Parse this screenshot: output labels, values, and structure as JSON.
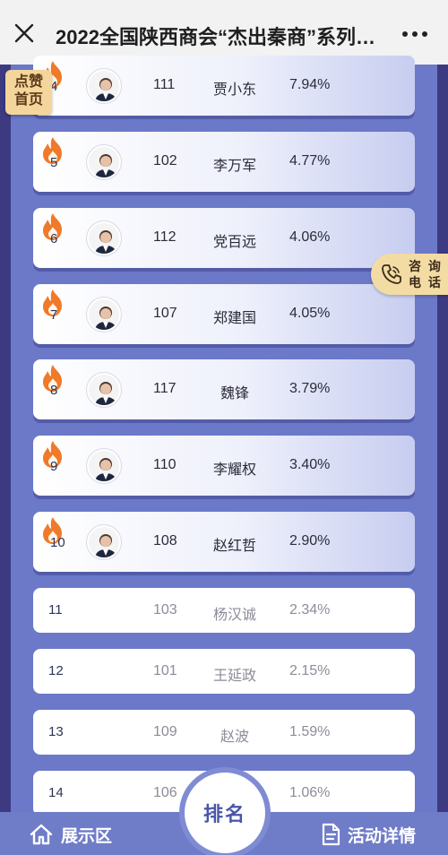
{
  "header": {
    "title": "2022全国陕西商会“杰出秦商”系列…",
    "close_icon": "close-icon",
    "more_icon": "more-icon"
  },
  "side_badges": {
    "like_line1": "点赞",
    "like_line2": "首页",
    "consult_line1": "咨 询",
    "consult_line2": "电 话"
  },
  "ranking": [
    {
      "rank": "4",
      "number": "111",
      "name": "贾小东",
      "percent": "7.94%"
    },
    {
      "rank": "5",
      "number": "102",
      "name": "李万军",
      "percent": "4.77%"
    },
    {
      "rank": "6",
      "number": "112",
      "name": "党百远",
      "percent": "4.06%"
    },
    {
      "rank": "7",
      "number": "107",
      "name": "郑建国",
      "percent": "4.05%"
    },
    {
      "rank": "8",
      "number": "117",
      "name": "魏锋",
      "percent": "3.79%"
    },
    {
      "rank": "9",
      "number": "110",
      "name": "李耀权",
      "percent": "3.40%"
    },
    {
      "rank": "10",
      "number": "108",
      "name": "赵红哲",
      "percent": "2.90%"
    },
    {
      "rank": "11",
      "number": "103",
      "name": "杨汉诚",
      "percent": "2.34%"
    },
    {
      "rank": "12",
      "number": "101",
      "name": "王延政",
      "percent": "2.15%"
    },
    {
      "rank": "13",
      "number": "109",
      "name": "赵波",
      "percent": "1.59%"
    },
    {
      "rank": "14",
      "number": "106",
      "name": "",
      "percent": "1.06%"
    }
  ],
  "bottom_nav": {
    "showcase_label": "展示区",
    "rank_label": "排名",
    "details_label": "活动详情"
  },
  "colors": {
    "accent": "#6b79c8",
    "frame": "#3d3a82",
    "flame": "#f07a2a",
    "badge": "#f4d59b"
  }
}
